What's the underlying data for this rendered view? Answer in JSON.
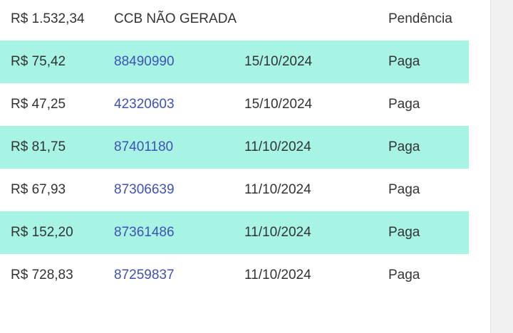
{
  "table": {
    "rows": [
      {
        "value": "R$ 1.532,34",
        "ccb": "CCB NÃO GERADA",
        "date": "",
        "status": "Pendência",
        "highlight": false,
        "ccb_link": false
      },
      {
        "value": "R$ 75,42",
        "ccb": "88490990",
        "date": "15/10/2024",
        "status": "Paga",
        "highlight": true,
        "ccb_link": true
      },
      {
        "value": "R$ 47,25",
        "ccb": "42320603",
        "date": "15/10/2024",
        "status": "Paga",
        "highlight": false,
        "ccb_link": true
      },
      {
        "value": "R$ 81,75",
        "ccb": "87401180",
        "date": "11/10/2024",
        "status": "Paga",
        "highlight": true,
        "ccb_link": true
      },
      {
        "value": "R$ 67,93",
        "ccb": "87306639",
        "date": "11/10/2024",
        "status": "Paga",
        "highlight": false,
        "ccb_link": true
      },
      {
        "value": "R$ 152,20",
        "ccb": "87361486",
        "date": "11/10/2024",
        "status": "Paga",
        "highlight": true,
        "ccb_link": true
      },
      {
        "value": "R$ 728,83",
        "ccb": "87259837",
        "date": "11/10/2024",
        "status": "Paga",
        "highlight": false,
        "ccb_link": true
      }
    ]
  },
  "colors": {
    "row_highlight": "#a7f4e4",
    "link": "#3f51b5",
    "text": "#333333"
  }
}
